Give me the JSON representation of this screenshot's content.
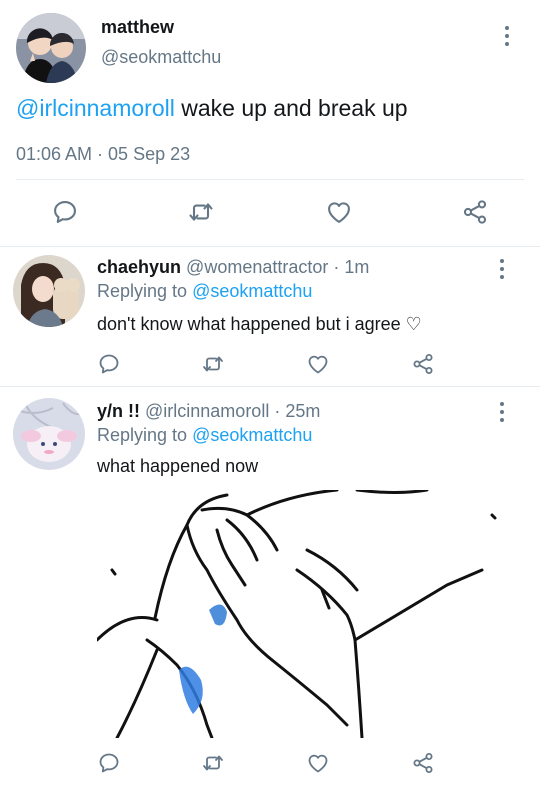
{
  "main_tweet": {
    "display_name": "matthew",
    "handle": "@seokmattchu",
    "mention": "@irlcinnamoroll",
    "text": " wake up and break up",
    "timestamp": "01:06 AM · 05 Sep 23"
  },
  "replies": [
    {
      "display_name": "chaehyun",
      "handle": "@womenattractor",
      "time": "· 1m",
      "replying_prefix": "Replying to ",
      "replying_handle": "@seokmattchu",
      "text": "don't know what happened but i agree ♡"
    },
    {
      "display_name": "y/n !!",
      "handle": "@irlcinnamoroll",
      "time": "· 25m",
      "replying_prefix": "Replying to ",
      "replying_handle": "@seokmattchu",
      "text": "what happened now"
    }
  ],
  "colors": {
    "accent": "#1da1f2",
    "muted": "#657786",
    "divider": "#e6ecf0"
  },
  "icons": [
    "reply-icon",
    "retweet-icon",
    "like-icon",
    "share-icon",
    "more-icon"
  ]
}
